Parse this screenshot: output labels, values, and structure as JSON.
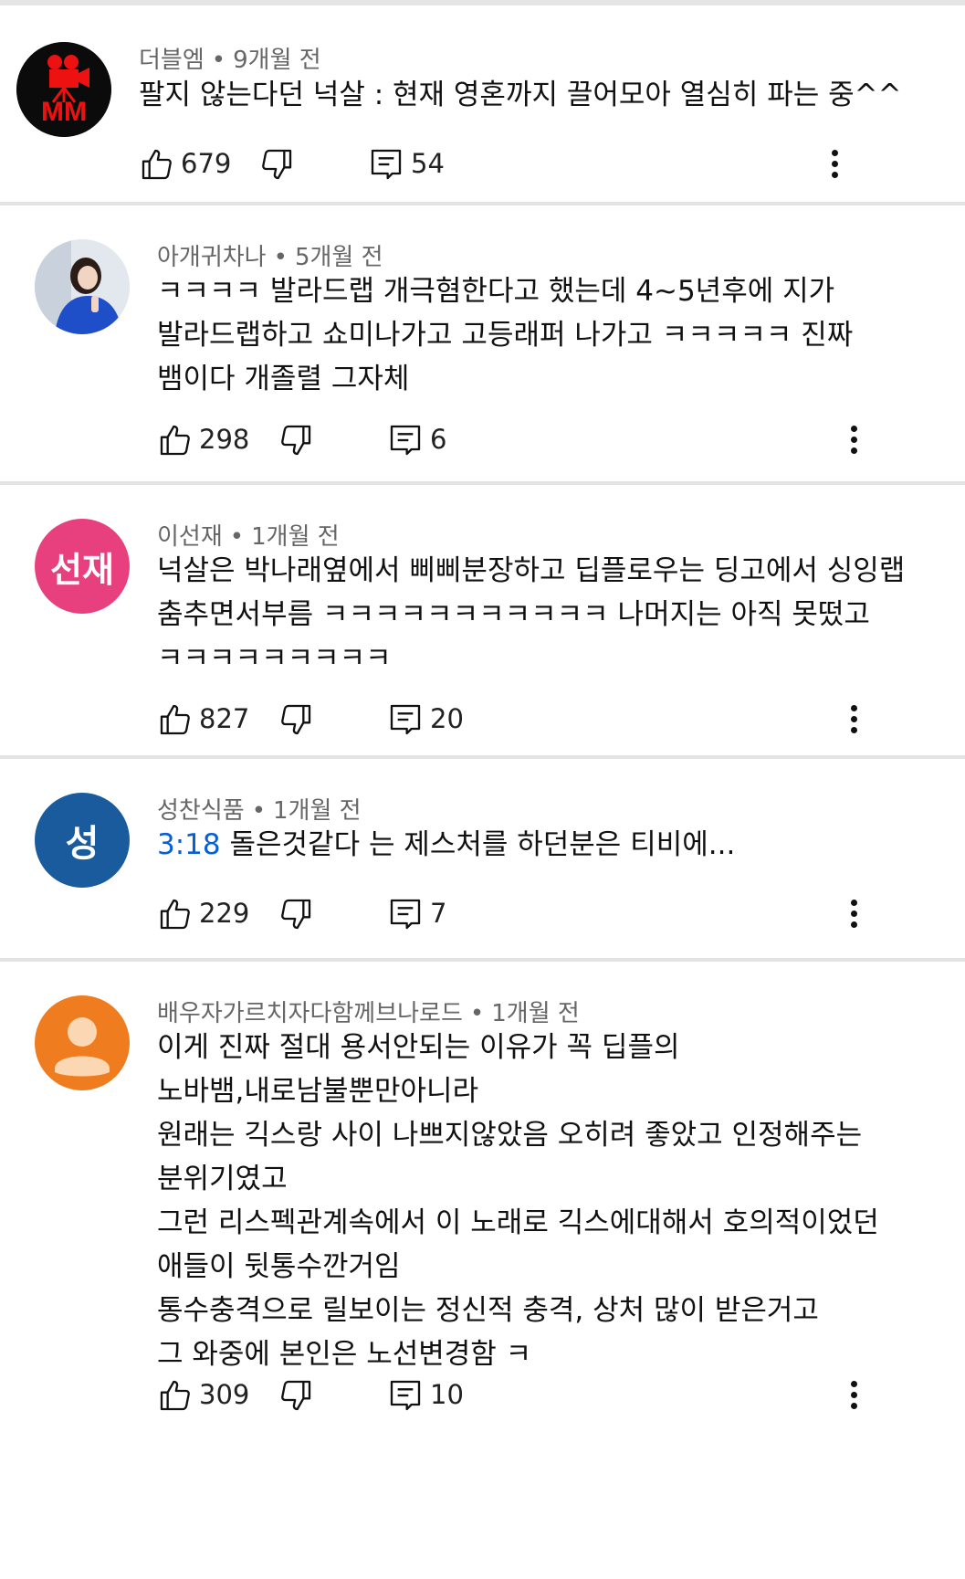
{
  "comments": [
    {
      "author": "더블엠",
      "time": "9개월 전",
      "avatar_text": "MM",
      "timestamp_link": "",
      "lines": [
        "팔지 않는다던 넉살 : 현재 영혼까지 끌어모아 열심히 파는 중^^"
      ],
      "likes": "679",
      "replies": "54"
    },
    {
      "author": "아개귀차나",
      "time": "5개월 전",
      "avatar_text": "",
      "timestamp_link": "",
      "lines": [
        "ㅋㅋㅋㅋ 발라드랩 개극혐한다고 했는데 4~5년후에 지가",
        "발라드랩하고 쇼미나가고 고등래퍼 나가고 ㅋㅋㅋㅋㅋ 진짜",
        "뱀이다 개졸렬 그자체"
      ],
      "likes": "298",
      "replies": "6"
    },
    {
      "author": "이선재",
      "time": "1개월 전",
      "avatar_text": "선재",
      "timestamp_link": "",
      "lines": [
        "넉살은 박나래옆에서 삐삐분장하고 딥플로우는 딩고에서 싱잉랩",
        "춤추면서부름 ㅋㅋㅋㅋㅋㅋㅋㅋㅋㅋㅋ 나머지는 아직 못떴고",
        "ㅋㅋㅋㅋㅋㅋㅋㅋㅋ"
      ],
      "likes": "827",
      "replies": "20"
    },
    {
      "author": "성찬식품",
      "time": "1개월 전",
      "avatar_text": "성",
      "timestamp_link": "3:18",
      "lines": [
        "돌은것같다 는 제스처를 하던분은 티비에..."
      ],
      "likes": "229",
      "replies": "7"
    },
    {
      "author": "배우자가르치자다함께브나로드",
      "time": "1개월 전",
      "avatar_text": "",
      "timestamp_link": "",
      "lines": [
        "이게 진짜 절대 용서안되는 이유가 꼭 딥플의",
        "노바뱀,내로남불뿐만아니라",
        "원래는 긱스랑 사이 나쁘지않았음 오히려 좋았고 인정해주는",
        "분위기였고",
        "그런 리스펙관계속에서 이 노래로 긱스에대해서 호의적이었던",
        "애들이 뒷통수깐거임",
        "통수충격으로 릴보이는 정신적 충격, 상처 많이 받은거고",
        "그 와중에 본인은 노선변경함 ㅋ"
      ],
      "likes": "309",
      "replies": "10"
    }
  ],
  "meta_separator": "•",
  "colors": {
    "meta_text": "#666666",
    "timestamp_link": "#065fd4",
    "avatar_selun": "#e8407e",
    "avatar_seong": "#1a5b9e",
    "avatar_default": "#ef7c1f"
  },
  "icons": [
    "thumb-up-icon",
    "thumb-down-icon",
    "reply-icon",
    "more-vert-icon"
  ]
}
